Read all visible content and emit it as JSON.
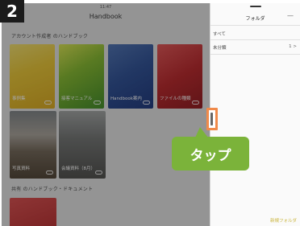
{
  "step": "2",
  "status_time": "11:47",
  "nav": {
    "title": "Handbook"
  },
  "sections": [
    {
      "label": "アカウント作成者 のハンドブック"
    },
    {
      "label": "共有 のハンドブック・ドキュメント"
    }
  ],
  "books": [
    {
      "label": "事例集"
    },
    {
      "label": "接客マニュアル"
    },
    {
      "label": "Handbook案内"
    },
    {
      "label": "ファイルの種類"
    },
    {
      "label": "写真資料"
    },
    {
      "label": "会議資料（8月）"
    },
    {
      "label": ""
    }
  ],
  "panel": {
    "title": "フォルダ",
    "close": "—",
    "rows": [
      {
        "label": "すべて",
        "count": ""
      },
      {
        "label": "未分類",
        "count": "1 >"
      }
    ],
    "new_folder": "新規フォルダ"
  },
  "callout": {
    "text": "タップ"
  },
  "colors": {
    "callout": "#7bb33a",
    "highlight": "#f08a4a",
    "badge": "#1b1b1b"
  }
}
